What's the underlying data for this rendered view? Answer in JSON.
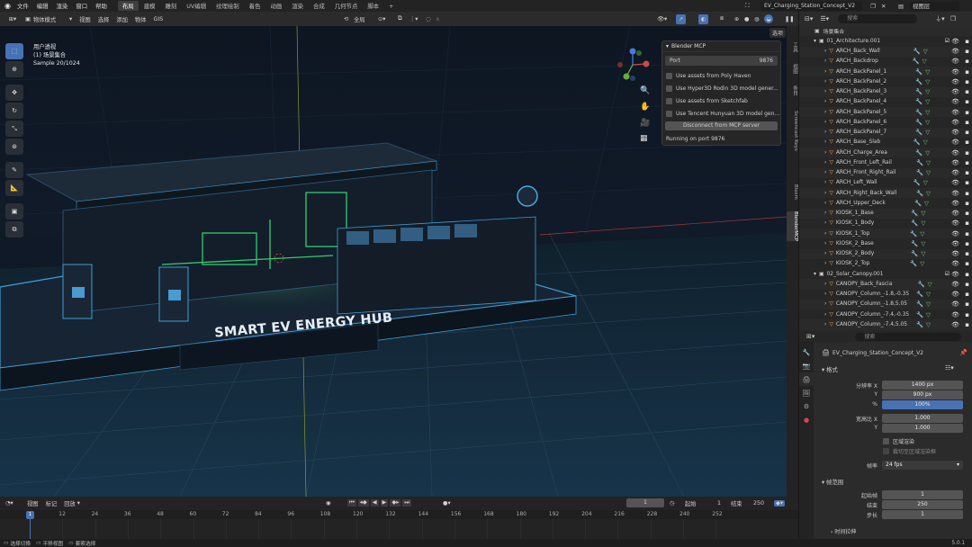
{
  "menu": [
    "文件",
    "编辑",
    "渲染",
    "窗口",
    "帮助"
  ],
  "workspaces": [
    "布局",
    "建模",
    "雕刻",
    "UV编辑",
    "纹理绘制",
    "着色",
    "动画",
    "渲染",
    "合成",
    "几何节点",
    "脚本"
  ],
  "active_workspace": "布局",
  "file_name": "EV_Charging_Station_Concept_V2",
  "view_layer": "视图层",
  "viewport_header": {
    "mode": "物体模式",
    "menus": [
      "视图",
      "选择",
      "添加",
      "物体",
      "GIS"
    ],
    "orientation": "全局",
    "options": "选项"
  },
  "overlay_info": {
    "view": "用户透视",
    "collection": "(1) 场景集合",
    "sample": "Sample 20/1024"
  },
  "sign_text": "SMART EV ENERGY HUB",
  "side_tabs": [
    "工具",
    "视图",
    "条目",
    "Screencast Keys",
    "Blosm",
    "BlenderMCP"
  ],
  "mcp": {
    "title": "Blender MCP",
    "port_label": "Port",
    "port_value": "9876",
    "options": [
      "Use assets from Poly Haven",
      "Use Hyper3D Rodin 3D model gener...",
      "Use assets from Sketchfab",
      "Use Tencent Hunyuan 3D model gen..."
    ],
    "disconnect": "Disconnect from MCP server",
    "status": "Running on port 9876"
  },
  "outliner": {
    "search_placeholder": "搜索",
    "root": "场景集合",
    "collection1": "01_Architecture.001",
    "items": [
      "ARCH_Back_Wall",
      "ARCH_Backdrop",
      "ARCH_BackPanel_1",
      "ARCH_BackPanel_2",
      "ARCH_BackPanel_3",
      "ARCH_BackPanel_4",
      "ARCH_BackPanel_5",
      "ARCH_BackPanel_6",
      "ARCH_BackPanel_7",
      "ARCH_Base_Slab",
      "ARCH_Charge_Area",
      "ARCH_Front_Left_Rail",
      "ARCH_Front_Right_Rail",
      "ARCH_Left_Wall",
      "ARCH_Right_Back_Wall",
      "ARCH_Upper_Deck",
      "KIOSK_1_Base",
      "KIOSK_1_Body",
      "KIOSK_1_Top",
      "KIOSK_2_Base",
      "KIOSK_2_Body",
      "KIOSK_2_Top"
    ],
    "collection2": "02_Solar_Canopy.001",
    "items2": [
      "CANOPY_Back_Fascia",
      "CANOPY_Column_-1.8,-0.35",
      "CANOPY_Column_-1.8,5.05",
      "CANOPY_Column_-7.4,-0.35",
      "CANOPY_Column_-7.4,5.05"
    ]
  },
  "properties": {
    "search_placeholder": "搜索",
    "scene_name": "EV_Charging_Station_Concept_V2",
    "format_section": "格式",
    "res_x_label": "分辨率 X",
    "res_x": "1400 px",
    "res_y_label": "Y",
    "res_y": "900 px",
    "pct_label": "%",
    "pct": "100%",
    "aspect_x_label": "宽高比 X",
    "aspect_x": "1.000",
    "aspect_y_label": "Y",
    "aspect_y": "1.000",
    "region_render": "区域渲染",
    "crop": "裁切至区域渲染框",
    "fps_label": "帧率",
    "fps": "24 fps",
    "frame_range_section": "帧范围",
    "start_label": "起始帧",
    "start": "1",
    "end_label": "结束",
    "end": "250",
    "step_label": "步长",
    "step": "1",
    "time_stretch": "时间拉伸"
  },
  "timeline": {
    "menus": [
      "视图",
      "标记",
      "回放"
    ],
    "current_frame": "1",
    "start_label": "起始",
    "start": "1",
    "end_label": "结束",
    "end": "250",
    "ticks": [
      "1",
      "12",
      "24",
      "36",
      "48",
      "60",
      "72",
      "84",
      "96",
      "108",
      "120",
      "132",
      "144",
      "156",
      "168",
      "180",
      "192",
      "204",
      "216",
      "228",
      "240",
      "252"
    ]
  },
  "status": {
    "left": [
      "选择切换",
      "平移视图",
      "套索选择"
    ],
    "version": "5.0.1"
  }
}
